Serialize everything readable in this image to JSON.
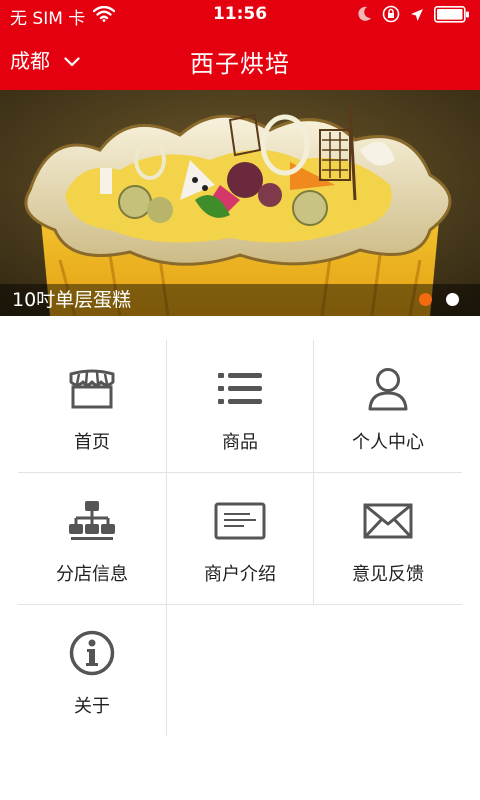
{
  "status_bar": {
    "carrier": "无 SIM 卡",
    "time": "11:56"
  },
  "header": {
    "city": "成都",
    "title": "西子烘培"
  },
  "banner": {
    "caption": "10吋单层蛋糕",
    "slide_count": 2,
    "active_slide": 1
  },
  "colors": {
    "brand_red": "#e4000f",
    "active_dot": "#f36a10",
    "icon_gray": "#555555"
  },
  "menu": [
    {
      "label": "首页",
      "icon": "storefront-icon"
    },
    {
      "label": "商品",
      "icon": "list-icon"
    },
    {
      "label": "个人中心",
      "icon": "user-icon"
    },
    {
      "label": "分店信息",
      "icon": "org-chart-icon"
    },
    {
      "label": "商户介绍",
      "icon": "id-card-icon"
    },
    {
      "label": "意见反馈",
      "icon": "envelope-icon"
    },
    {
      "label": "关于",
      "icon": "info-icon"
    }
  ]
}
